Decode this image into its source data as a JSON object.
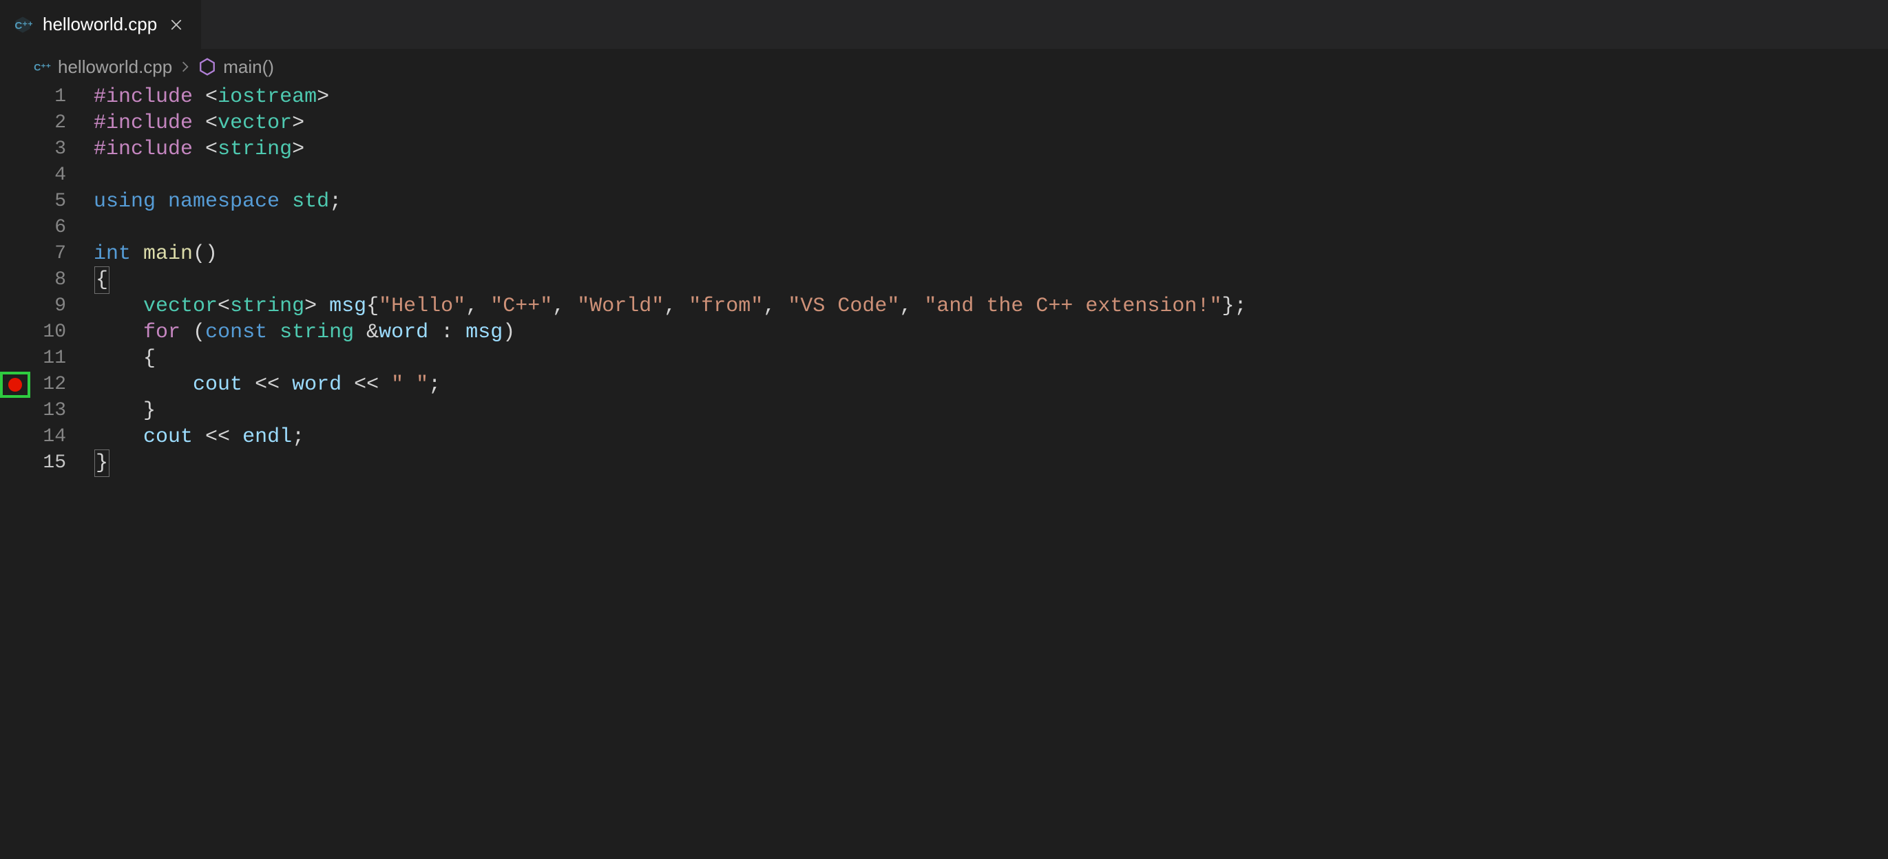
{
  "tab": {
    "filename": "helloworld.cpp",
    "icon": "cpp-file-icon",
    "close": "close-icon"
  },
  "breadcrumb": {
    "file": "helloworld.cpp",
    "symbol": "main()"
  },
  "breakpoint_line": 12,
  "code_lines": [
    {
      "n": 1,
      "tokens": [
        [
          "directive",
          "#include"
        ],
        [
          "ws",
          " "
        ],
        [
          "punct",
          "<"
        ],
        [
          "type",
          "iostream"
        ],
        [
          "punct",
          ">"
        ]
      ]
    },
    {
      "n": 2,
      "tokens": [
        [
          "directive",
          "#include"
        ],
        [
          "ws",
          " "
        ],
        [
          "punct",
          "<"
        ],
        [
          "type",
          "vector"
        ],
        [
          "punct",
          ">"
        ]
      ]
    },
    {
      "n": 3,
      "tokens": [
        [
          "directive",
          "#include"
        ],
        [
          "ws",
          " "
        ],
        [
          "punct",
          "<"
        ],
        [
          "type",
          "string"
        ],
        [
          "punct",
          ">"
        ]
      ]
    },
    {
      "n": 4,
      "tokens": []
    },
    {
      "n": 5,
      "tokens": [
        [
          "keyword",
          "using"
        ],
        [
          "ws",
          " "
        ],
        [
          "keyword",
          "namespace"
        ],
        [
          "ws",
          " "
        ],
        [
          "ns",
          "std"
        ],
        [
          "punct",
          ";"
        ]
      ]
    },
    {
      "n": 6,
      "tokens": []
    },
    {
      "n": 7,
      "tokens": [
        [
          "keyword",
          "int"
        ],
        [
          "ws",
          " "
        ],
        [
          "func",
          "main"
        ],
        [
          "punct",
          "()"
        ]
      ]
    },
    {
      "n": 8,
      "tokens": [
        [
          "boxed",
          "{"
        ]
      ]
    },
    {
      "n": 9,
      "tokens": [
        [
          "ws",
          "    "
        ],
        [
          "type",
          "vector"
        ],
        [
          "punct",
          "<"
        ],
        [
          "type",
          "string"
        ],
        [
          "punct",
          ">"
        ],
        [
          "ws",
          " "
        ],
        [
          "var",
          "msg"
        ],
        [
          "punct",
          "{"
        ],
        [
          "string",
          "\"Hello\""
        ],
        [
          "punct",
          ", "
        ],
        [
          "string",
          "\"C++\""
        ],
        [
          "punct",
          ", "
        ],
        [
          "string",
          "\"World\""
        ],
        [
          "punct",
          ", "
        ],
        [
          "string",
          "\"from\""
        ],
        [
          "punct",
          ", "
        ],
        [
          "string",
          "\"VS Code\""
        ],
        [
          "punct",
          ", "
        ],
        [
          "string",
          "\"and the C++ extension!\""
        ],
        [
          "punct",
          "};"
        ]
      ]
    },
    {
      "n": 10,
      "tokens": [
        [
          "ws",
          "    "
        ],
        [
          "control",
          "for"
        ],
        [
          "ws",
          " "
        ],
        [
          "punct",
          "("
        ],
        [
          "keyword",
          "const"
        ],
        [
          "ws",
          " "
        ],
        [
          "type",
          "string"
        ],
        [
          "ws",
          " "
        ],
        [
          "op",
          "&"
        ],
        [
          "var",
          "word"
        ],
        [
          "ws",
          " "
        ],
        [
          "punct",
          ":"
        ],
        [
          "ws",
          " "
        ],
        [
          "var",
          "msg"
        ],
        [
          "punct",
          ")"
        ]
      ]
    },
    {
      "n": 11,
      "tokens": [
        [
          "ws",
          "    "
        ],
        [
          "punct",
          "{"
        ]
      ]
    },
    {
      "n": 12,
      "tokens": [
        [
          "ws",
          "        "
        ],
        [
          "var",
          "cout"
        ],
        [
          "ws",
          " "
        ],
        [
          "op",
          "<<"
        ],
        [
          "ws",
          " "
        ],
        [
          "var",
          "word"
        ],
        [
          "ws",
          " "
        ],
        [
          "op",
          "<<"
        ],
        [
          "ws",
          " "
        ],
        [
          "string",
          "\" \""
        ],
        [
          "punct",
          ";"
        ]
      ]
    },
    {
      "n": 13,
      "tokens": [
        [
          "ws",
          "    "
        ],
        [
          "punct",
          "}"
        ]
      ]
    },
    {
      "n": 14,
      "tokens": [
        [
          "ws",
          "    "
        ],
        [
          "var",
          "cout"
        ],
        [
          "ws",
          " "
        ],
        [
          "op",
          "<<"
        ],
        [
          "ws",
          " "
        ],
        [
          "var",
          "endl"
        ],
        [
          "punct",
          ";"
        ]
      ]
    },
    {
      "n": 15,
      "tokens": [
        [
          "boxed",
          "}"
        ]
      ]
    }
  ]
}
